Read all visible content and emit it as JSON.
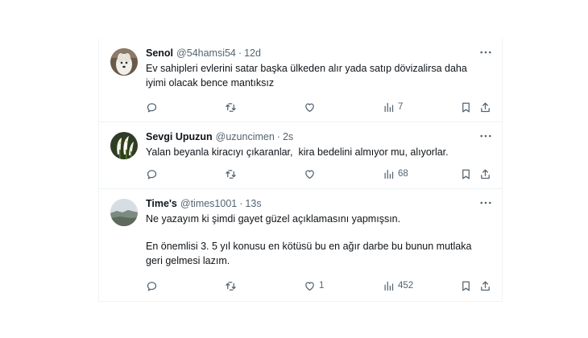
{
  "tweets": [
    {
      "name": "Senol",
      "handle": "@54hamsi54",
      "dot": "·",
      "time": "12d",
      "lines": [
        "Ev sahipleri evlerini satar başka ülkeden alır yada satıp dövizalirsa daha",
        "iyimi olacak bence mantıksız"
      ],
      "replies": "",
      "retweets": "",
      "likes": "",
      "views": "7",
      "avatar": "white-dog-avatar"
    },
    {
      "name": "Sevgi Upuzun",
      "handle": "@uzuncimen",
      "dot": "·",
      "time": "2s",
      "lines": [
        "Yalan beyanla kiracıyı çıkaranlar,  kira bedelini almıyor mu, alıyorlar."
      ],
      "replies": "",
      "retweets": "",
      "likes": "",
      "views": "68",
      "avatar": "calla-lily-avatar"
    },
    {
      "name": "Time's",
      "handle": "@times1001",
      "dot": "·",
      "time": "13s",
      "lines": [
        "Ne yazayım ki şimdi gayet güzel açıklamasını yapmışsın.",
        "En önemlisi 3. 5 yıl konusu en kötüsü bu en ağır darbe bu bunun mutlaka",
        "geri gelmesi lazım."
      ],
      "replies": "",
      "retweets": "",
      "likes": "1",
      "views": "452",
      "avatar": "landscape-avatar"
    }
  ],
  "icons": {
    "more": "more-icon",
    "reply": "reply-icon",
    "retweet": "retweet-icon",
    "like": "heart-icon",
    "views": "views-icon",
    "bookmark": "bookmark-icon",
    "share": "share-icon"
  },
  "colors": {
    "text": "#0f1419",
    "secondary": "#536471",
    "border": "#eff3f4"
  }
}
